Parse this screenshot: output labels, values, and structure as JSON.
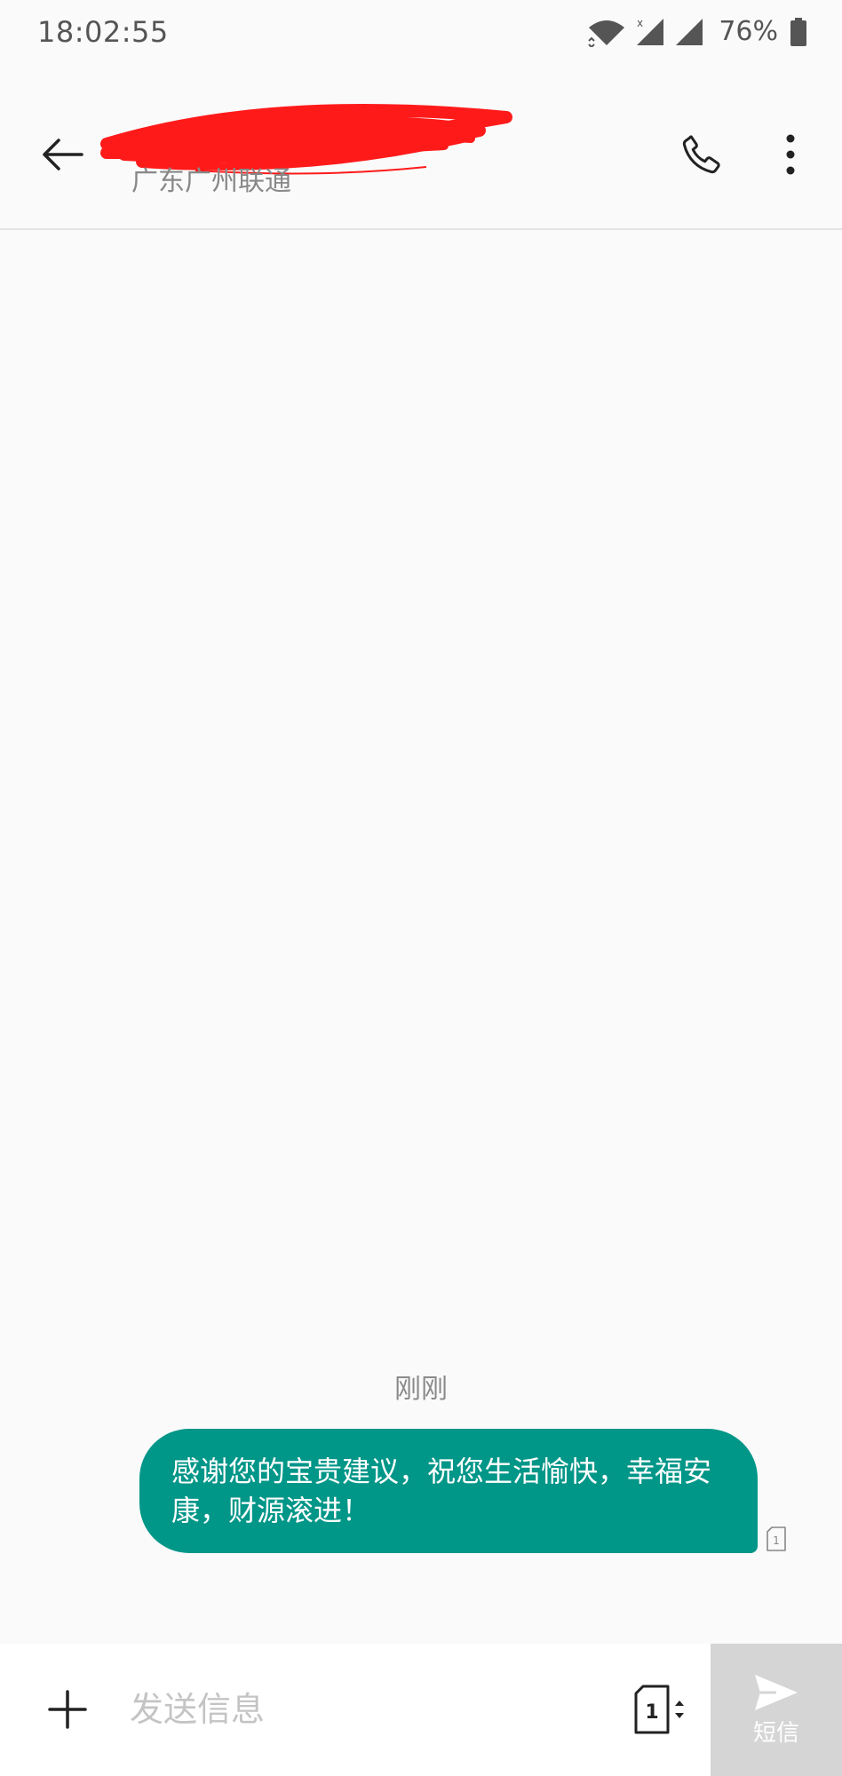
{
  "status_bar": {
    "time": "18:02:55",
    "battery_percent": "76%"
  },
  "header": {
    "contact_location": "广东广州联通"
  },
  "conversation": {
    "timestamp": "刚刚",
    "messages": [
      {
        "direction": "outgoing",
        "text": "感谢您的宝贵建议，祝您生活愉快，幸福安康，财源滚进！",
        "sim": "1"
      }
    ]
  },
  "compose": {
    "placeholder": "发送信息",
    "sim_slot": "1",
    "send_label": "短信"
  },
  "colors": {
    "accent": "#009688",
    "background": "#fafafa",
    "send_disabled": "#d5d5d5",
    "redaction": "#ff1a1a"
  },
  "icons": {
    "back": "arrow-left-icon",
    "call": "phone-icon",
    "more": "more-vertical-icon",
    "attach": "plus-icon",
    "sim": "sim-card-icon",
    "send": "send-icon",
    "wifi": "wifi-icon",
    "signal": "signal-icon",
    "battery": "battery-icon"
  }
}
